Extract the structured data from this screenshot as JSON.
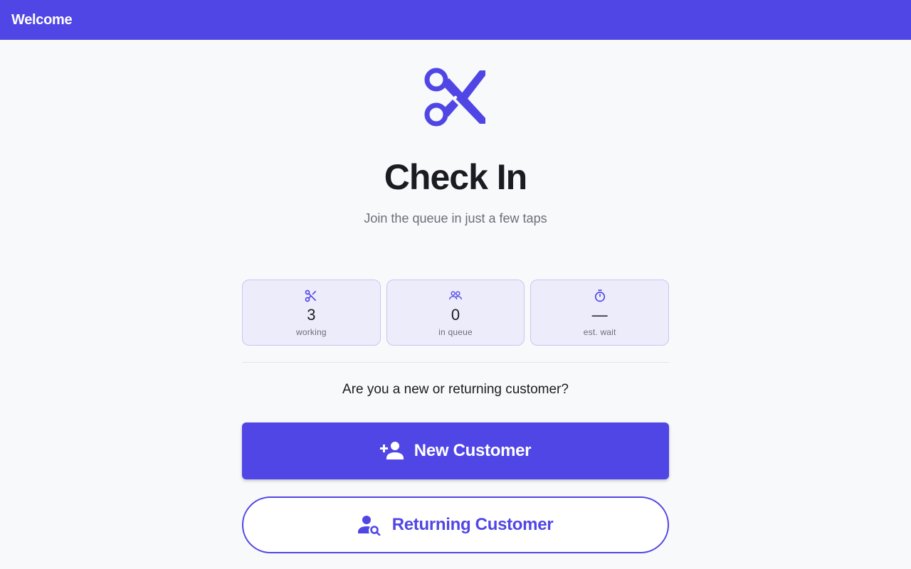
{
  "app": {
    "title": "Welcome"
  },
  "hero": {
    "icon": "scissors-icon",
    "heading": "Check In",
    "subtitle": "Join the queue in just a few taps"
  },
  "stats": [
    {
      "icon": "scissors-icon",
      "value": "3",
      "label": "working"
    },
    {
      "icon": "people-icon",
      "value": "0",
      "label": "in queue"
    },
    {
      "icon": "timer-icon",
      "value": "—",
      "label": "est. wait"
    }
  ],
  "prompt": {
    "question": "Are you a new or returning customer?"
  },
  "actions": {
    "new_customer": {
      "label": "New Customer",
      "icon": "person-add-icon"
    },
    "returning_customer": {
      "label": "Returning Customer",
      "icon": "person-search-icon"
    }
  },
  "colors": {
    "accent": "#5046e5",
    "background": "#f8f9fb",
    "stat_bg": "#edecfa"
  }
}
